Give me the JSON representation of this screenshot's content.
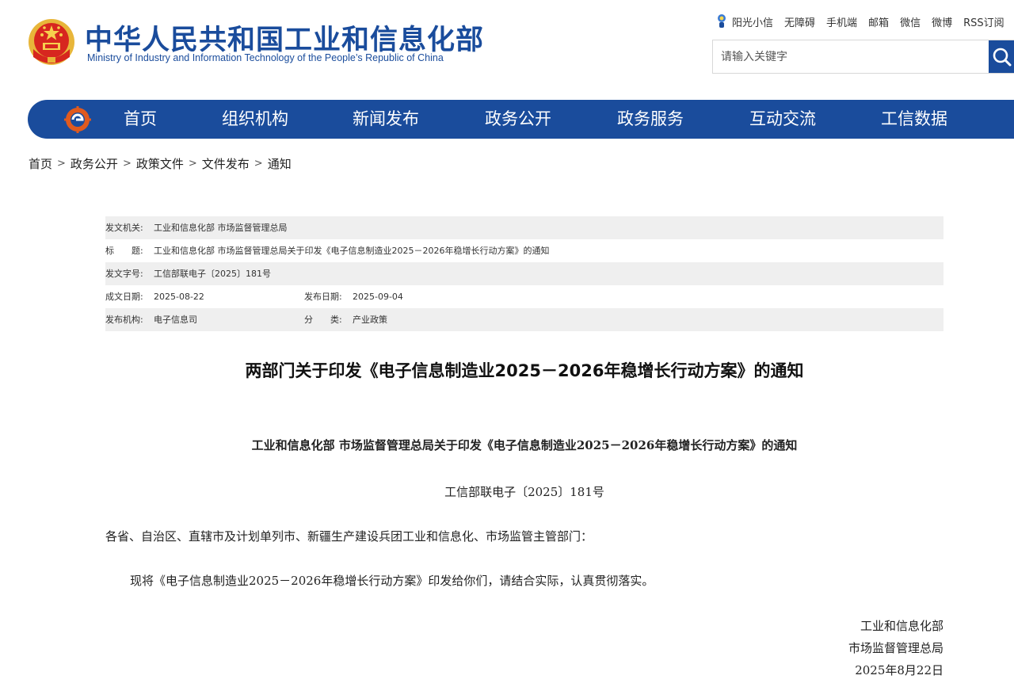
{
  "header": {
    "site_title": "中华人民共和国工业和信息化部",
    "site_subtitle": "Ministry of Industry and Information Technology of the People’s Republic of China",
    "top_links": [
      "阳光小信",
      "无障碍",
      "手机端",
      "邮箱",
      "微信",
      "微博",
      "RSS订阅"
    ],
    "search_placeholder": "请输入关键字",
    "brand_color": "#1a4c9c"
  },
  "nav": {
    "items": [
      "首页",
      "组织机构",
      "新闻发布",
      "政务公开",
      "政务服务",
      "互动交流",
      "工信数据"
    ]
  },
  "breadcrumb": [
    "首页",
    "政务公开",
    "政策文件",
    "文件发布",
    "通知"
  ],
  "meta": {
    "issuer_label": "发文机关:",
    "issuer_value": "工业和信息化部 市场监督管理总局",
    "title_label": "标　　题:",
    "title_value": "工业和信息化部 市场监督管理总局关于印发《电子信息制造业2025－2026年稳增长行动方案》的通知",
    "docno_label": "发文字号:",
    "docno_value": "工信部联电子〔2025〕181号",
    "created_label": "成文日期:",
    "created_value": "2025-08-22",
    "published_label": "发布日期:",
    "published_value": "2025-09-04",
    "org_label": "发布机构:",
    "org_value": "电子信息司",
    "category_label": "分　　类:",
    "category_value": "产业政策"
  },
  "article": {
    "title": "两部门关于印发《电子信息制造业2025－2026年稳增长行动方案》的通知",
    "heading": "工业和信息化部 市场监督管理总局关于印发《电子信息制造业2025－2026年稳增长行动方案》的通知",
    "doc_number": "工信部联电子〔2025〕181号",
    "salutation": "各省、自治区、直辖市及计划单列市、新疆生产建设兵团工业和信息化、市场监管主管部门：",
    "body": "现将《电子信息制造业2025－2026年稳增长行动方案》印发给你们，请结合实际，认真贯彻落实。",
    "signatures": [
      "工业和信息化部",
      "市场监督管理总局",
      "2025年8月22日"
    ]
  }
}
